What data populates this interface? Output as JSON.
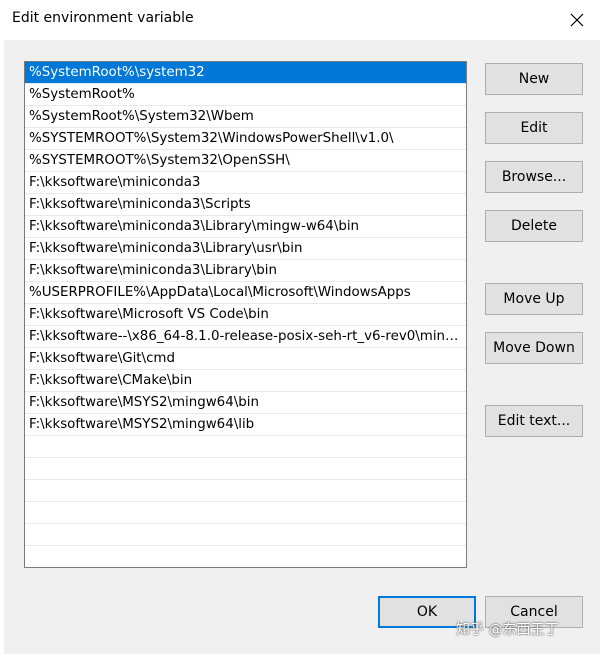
{
  "window": {
    "title": "Edit environment variable"
  },
  "list": {
    "items": [
      "%SystemRoot%\\system32",
      "%SystemRoot%",
      "%SystemRoot%\\System32\\Wbem",
      "%SYSTEMROOT%\\System32\\WindowsPowerShell\\v1.0\\",
      "%SYSTEMROOT%\\System32\\OpenSSH\\",
      "F:\\kksoftware\\miniconda3",
      "F:\\kksoftware\\miniconda3\\Scripts",
      "F:\\kksoftware\\miniconda3\\Library\\mingw-w64\\bin",
      "F:\\kksoftware\\miniconda3\\Library\\usr\\bin",
      "F:\\kksoftware\\miniconda3\\Library\\bin",
      "%USERPROFILE%\\AppData\\Local\\Microsoft\\WindowsApps",
      "F:\\kksoftware\\Microsoft VS Code\\bin",
      "F:\\kksoftware--\\x86_64-8.1.0-release-posix-seh-rt_v6-rev0\\mingw...",
      "F:\\kksoftware\\Git\\cmd",
      "F:\\kksoftware\\CMake\\bin",
      "F:\\kksoftware\\MSYS2\\mingw64\\bin",
      "F:\\kksoftware\\MSYS2\\mingw64\\lib"
    ],
    "selected_index": 0
  },
  "buttons": {
    "new": "New",
    "edit": "Edit",
    "browse": "Browse...",
    "delete": "Delete",
    "move_up": "Move Up",
    "move_down": "Move Down",
    "edit_text": "Edit text...",
    "ok": "OK",
    "cancel": "Cancel"
  },
  "watermark": "知乎 @东西王丁",
  "colors": {
    "selection": "#0078d7",
    "default_button_border": "#0078d7"
  },
  "icons": {
    "close": "close-icon"
  }
}
